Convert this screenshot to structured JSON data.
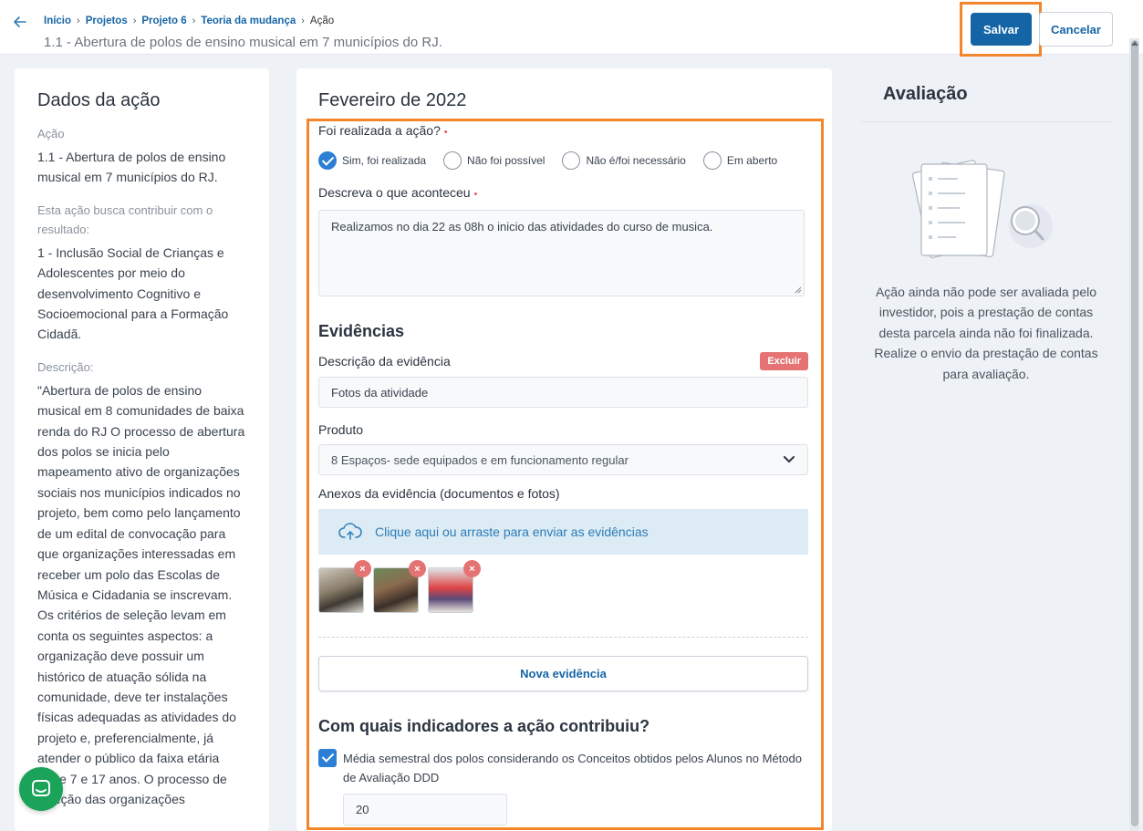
{
  "header": {
    "breadcrumb": [
      "Início",
      "Projetos",
      "Projeto 6",
      "Teoria da mudança"
    ],
    "breadcrumb_current": "Ação",
    "subtitle": "1.1 - Abertura de polos de ensino musical em 7 municípios do RJ.",
    "save_label": "Salvar",
    "cancel_label": "Cancelar"
  },
  "left": {
    "title": "Dados da ação",
    "acao_label": "Ação",
    "acao_value": "1.1 - Abertura de polos de ensino musical em 7 municípios do RJ.",
    "resultado_label": "Esta ação busca contribuir com o resultado:",
    "resultado_value": "1 - Inclusão Social de Crianças e Adolescentes por meio do desenvolvimento Cognitivo e Socioemocional para a Formação Cidadã.",
    "descricao_label": "Descrição:",
    "descricao_value": "\"Abertura de polos de ensino musical em 8 comunidades de baixa renda do RJ O processo de abertura dos polos se inicia pelo mapeamento ativo de organizações sociais nos municípios indicados no projeto, bem como pelo lançamento de um edital de convocação para que organizações interessadas em receber um polo das Escolas de Música e Cidadania se inscrevam. Os critérios de seleção levam em conta os seguintes aspectos: a organização deve possuir um histórico de atuação sólida na comunidade, deve ter instalações físicas adequadas as atividades do projeto e, preferencialmente, já atender o público da faixa etária entre 7 e 17 anos. O processo de seleção das organizações"
  },
  "form": {
    "month": "Fevereiro de 2022",
    "realizada_label": "Foi realizada a ação?",
    "required_mark": "•",
    "options": [
      "Sim, foi realizada",
      "Não foi possível",
      "Não é/foi necessário",
      "Em aberto"
    ],
    "descreva_label": "Descreva o que aconteceu",
    "descreva_value": "Realizamos no dia 22 as 08h o inicio das atividades do curso de musica.",
    "evidencias_title": "Evidências",
    "desc_evidencia_label": "Descrição da evidência",
    "excluir_label": "Excluir",
    "desc_evidencia_value": "Fotos da atividade",
    "produto_label": "Produto",
    "produto_value": "8 Espaços- sede equipados e em funcionamento regular",
    "anexos_label": "Anexos da evidência (documentos e fotos)",
    "upload_text": "Clique aqui ou arraste para enviar as evidências",
    "remove_mark": "×",
    "nova_evidencia_label": "Nova evidência",
    "indicadores_title": "Com quais indicadores a ação contribuiu?",
    "indicador_label": "Média semestral dos polos considerando os Conceitos obtidos pelos Alunos no Método de Avaliação DDD",
    "indicador_value": "20"
  },
  "right": {
    "title": "Avaliação",
    "message": "Ação ainda não pode ser avaliada pelo investidor, pois a prestação de contas desta parcela ainda não foi finalizada. Realize o envio da prestação de contas para avaliação."
  }
}
